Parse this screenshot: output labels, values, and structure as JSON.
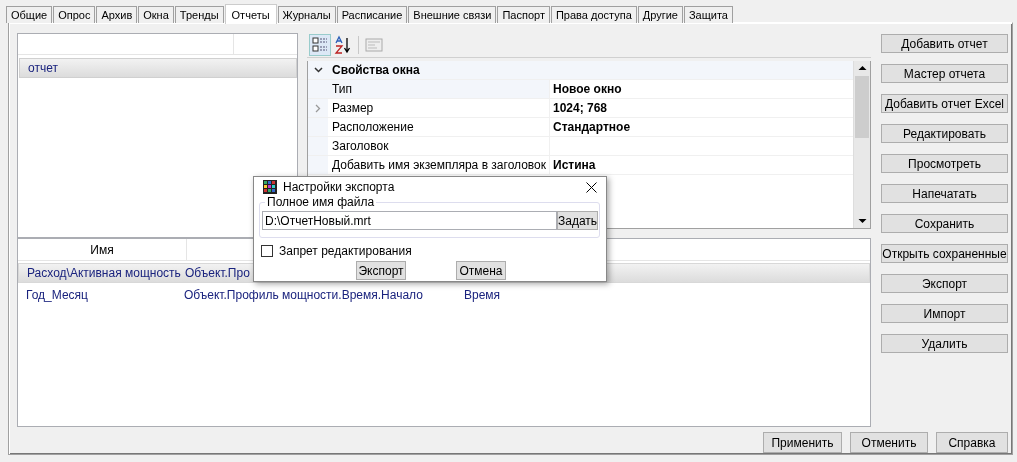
{
  "tabs": [
    {
      "label": "Общие",
      "selected": false
    },
    {
      "label": "Опрос",
      "selected": false
    },
    {
      "label": "Архив",
      "selected": false
    },
    {
      "label": "Окна",
      "selected": false
    },
    {
      "label": "Тренды",
      "selected": false
    },
    {
      "label": "Отчеты",
      "selected": true
    },
    {
      "label": "Журналы",
      "selected": false
    },
    {
      "label": "Расписание",
      "selected": false
    },
    {
      "label": "Внешние связи",
      "selected": false
    },
    {
      "label": "Паспорт",
      "selected": false
    },
    {
      "label": "Права доступа",
      "selected": false
    },
    {
      "label": "Другие",
      "selected": false
    },
    {
      "label": "Защита",
      "selected": false
    }
  ],
  "report_list": {
    "items": [
      {
        "label": "отчет",
        "selected": true
      }
    ]
  },
  "property_grid": {
    "categories": [
      {
        "label": "Свойства окна",
        "expanded": true,
        "rows": [
          {
            "name": "Тип",
            "value": "Новое окно",
            "expandable": false,
            "selected": true
          },
          {
            "name": "Размер",
            "value": "1024; 768",
            "expandable": true,
            "selected": false
          },
          {
            "name": "Расположение",
            "value": "Стандартное",
            "expandable": false,
            "selected": false
          },
          {
            "name": "Заголовок",
            "expandable": false,
            "selected": false
          },
          {
            "name": "Добавить имя экземпляра в заголовок",
            "value": "Истина",
            "expandable": false,
            "selected": false
          }
        ]
      }
    ]
  },
  "table": {
    "columns": [
      "Имя"
    ],
    "rows": [
      {
        "cells": [
          "Расход\\Активная мощность",
          "Объект.Про"
        ],
        "selected": true
      },
      {
        "cells": [
          "Год_Месяц",
          "Объект.Профиль мощности.Время.Начало",
          "Время"
        ],
        "selected": false
      }
    ]
  },
  "actions": [
    "Добавить отчет",
    "Мастер отчета",
    "Добавить отчет Excel",
    "Редактировать",
    "Просмотреть",
    "Напечатать",
    "Сохранить",
    "Открыть сохраненные",
    "Экспорт",
    "Импорт",
    "Удалить"
  ],
  "footer_buttons": [
    "Применить",
    "Отменить",
    "Справка"
  ],
  "dialog": {
    "title": "Настройки экспорта",
    "group_label": "Полное имя файла",
    "file_path": "D:\\ОтчетНовый.mrt",
    "browse_button": "Задать",
    "checkbox": {
      "label": "Запрет редактирования",
      "checked": false
    },
    "buttons": [
      "Экспорт",
      "Отмена"
    ]
  }
}
